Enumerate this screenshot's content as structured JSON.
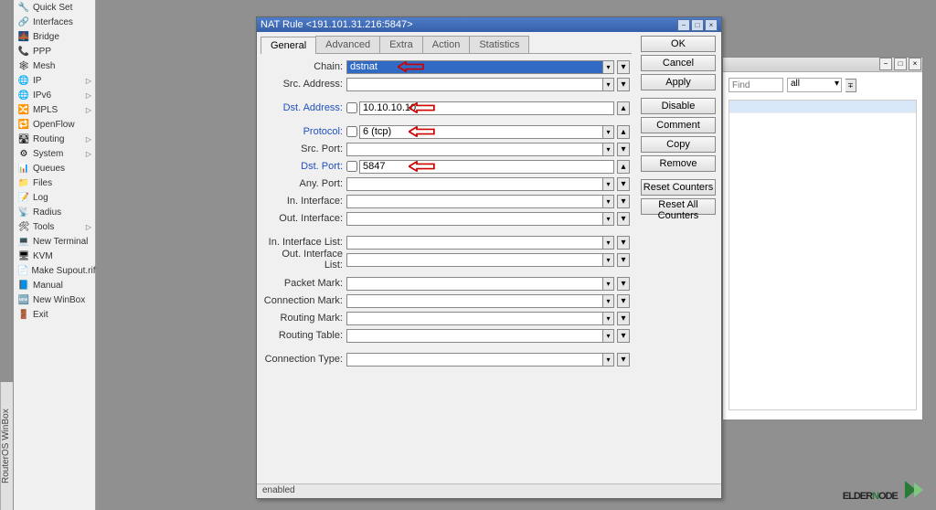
{
  "vert_title": "RouterOS WinBox",
  "sidebar": {
    "items": [
      {
        "icon": "🔧",
        "label": "Quick Set",
        "caret": false
      },
      {
        "icon": "🔗",
        "label": "Interfaces",
        "caret": false
      },
      {
        "icon": "🌉",
        "label": "Bridge",
        "caret": false
      },
      {
        "icon": "📞",
        "label": "PPP",
        "caret": false
      },
      {
        "icon": "🕸",
        "label": "Mesh",
        "caret": false
      },
      {
        "icon": "🌐",
        "label": "IP",
        "caret": true
      },
      {
        "icon": "🌐",
        "label": "IPv6",
        "caret": true
      },
      {
        "icon": "🔀",
        "label": "MPLS",
        "caret": true
      },
      {
        "icon": "🔁",
        "label": "OpenFlow",
        "caret": false
      },
      {
        "icon": "🛣",
        "label": "Routing",
        "caret": true
      },
      {
        "icon": "⚙",
        "label": "System",
        "caret": true
      },
      {
        "icon": "📊",
        "label": "Queues",
        "caret": false
      },
      {
        "icon": "📁",
        "label": "Files",
        "caret": false
      },
      {
        "icon": "📝",
        "label": "Log",
        "caret": false
      },
      {
        "icon": "📡",
        "label": "Radius",
        "caret": false
      },
      {
        "icon": "🛠",
        "label": "Tools",
        "caret": true
      },
      {
        "icon": "💻",
        "label": "New Terminal",
        "caret": false
      },
      {
        "icon": "🖥",
        "label": "KVM",
        "caret": false
      },
      {
        "icon": "📄",
        "label": "Make Supout.rif",
        "caret": false
      },
      {
        "icon": "📘",
        "label": "Manual",
        "caret": false
      },
      {
        "icon": "🆕",
        "label": "New WinBox",
        "caret": false
      },
      {
        "icon": "🚪",
        "label": "Exit",
        "caret": false
      }
    ]
  },
  "bg_window": {
    "find_placeholder": "Find",
    "combo_value": "all"
  },
  "dialog": {
    "title": "NAT Rule <191.101.31.216:5847>",
    "tabs": [
      "General",
      "Advanced",
      "Extra",
      "Action",
      "Statistics"
    ],
    "active_tab": 0,
    "fields": {
      "chain": {
        "label": "Chain:",
        "value": "dstnat",
        "arrow": true,
        "highlighted": true,
        "dd": true,
        "blue": false
      },
      "src_address": {
        "label": "Src. Address:",
        "value": "",
        "dd": true
      },
      "dst_address": {
        "label": "Dst. Address:",
        "value": "10.10.10.10",
        "cb": true,
        "arrow": true,
        "tri": true,
        "blue": true
      },
      "protocol": {
        "label": "Protocol:",
        "value": "6 (tcp)",
        "cb": true,
        "arrow": true,
        "dd": true,
        "tri": true,
        "blue": true
      },
      "src_port": {
        "label": "Src. Port:",
        "value": "",
        "dd": true
      },
      "dst_port": {
        "label": "Dst. Port:",
        "value": "5847",
        "cb": true,
        "arrow": true,
        "tri": true,
        "blue": true
      },
      "any_port": {
        "label": "Any. Port:",
        "value": "",
        "dd": true
      },
      "in_interface": {
        "label": "In. Interface:",
        "value": "",
        "dd": true
      },
      "out_interface": {
        "label": "Out. Interface:",
        "value": "",
        "dd": true
      },
      "in_if_list": {
        "label": "In. Interface List:",
        "value": "",
        "dd": true
      },
      "out_if_list": {
        "label": "Out. Interface List:",
        "value": "",
        "dd": true
      },
      "packet_mark": {
        "label": "Packet Mark:",
        "value": "",
        "dd": true
      },
      "conn_mark": {
        "label": "Connection Mark:",
        "value": "",
        "dd": true
      },
      "routing_mark": {
        "label": "Routing Mark:",
        "value": "",
        "dd": true
      },
      "routing_table": {
        "label": "Routing Table:",
        "value": "",
        "dd": true
      },
      "conn_type": {
        "label": "Connection Type:",
        "value": "",
        "dd": true
      }
    },
    "buttons": {
      "ok": "OK",
      "cancel": "Cancel",
      "apply": "Apply",
      "disable": "Disable",
      "comment": "Comment",
      "copy": "Copy",
      "remove": "Remove",
      "reset": "Reset Counters",
      "reset_all": "Reset All Counters"
    },
    "status": "enabled"
  },
  "logo": {
    "text1": "ELDER",
    "text2": "N",
    "text3": "ODE"
  }
}
